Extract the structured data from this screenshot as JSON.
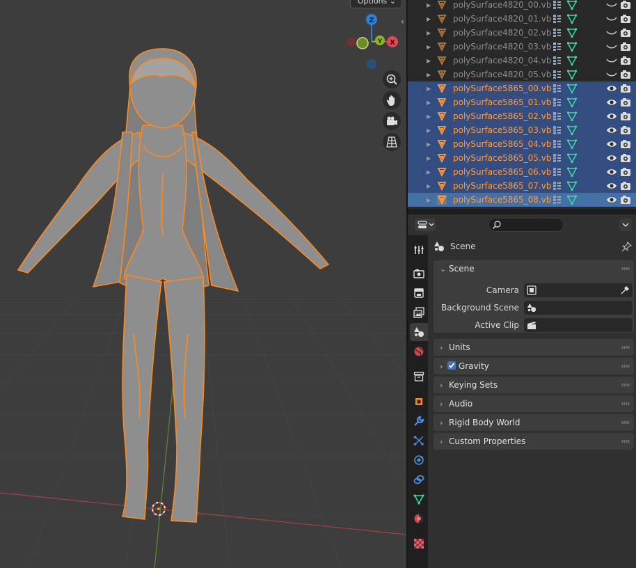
{
  "viewport": {
    "options_label": "Options",
    "gizmo": {
      "z": "Z",
      "y": "Y",
      "x": "X"
    },
    "nav_buttons": [
      "zoom-in-icon",
      "pan-hand-icon",
      "camera-view-icon",
      "perspective-grid-icon"
    ]
  },
  "outliner": {
    "rows": [
      {
        "name": "polySurface4820_00.vb",
        "selected": false
      },
      {
        "name": "polySurface4820_01.vb",
        "selected": false
      },
      {
        "name": "polySurface4820_02.vb",
        "selected": false
      },
      {
        "name": "polySurface4820_03.vb",
        "selected": false
      },
      {
        "name": "polySurface4820_04.vb",
        "selected": false
      },
      {
        "name": "polySurface4820_05.vb",
        "selected": false
      },
      {
        "name": "polySurface5865_00.vb",
        "selected": true
      },
      {
        "name": "polySurface5865_01.vb",
        "selected": true
      },
      {
        "name": "polySurface5865_02.vb",
        "selected": true
      },
      {
        "name": "polySurface5865_03.vb",
        "selected": true
      },
      {
        "name": "polySurface5865_04.vb",
        "selected": true
      },
      {
        "name": "polySurface5865_05.vb",
        "selected": true
      },
      {
        "name": "polySurface5865_06.vb",
        "selected": true
      },
      {
        "name": "polySurface5865_07.vb",
        "selected": true
      },
      {
        "name": "polySurface5865_08.vb",
        "selected": true,
        "active": true
      }
    ]
  },
  "properties": {
    "context_title": "Scene",
    "scene_panel": {
      "title": "Scene",
      "fields": [
        {
          "label": "Camera"
        },
        {
          "label": "Background Scene"
        },
        {
          "label": "Active Clip"
        }
      ]
    },
    "collapsed_panels": [
      "Units",
      "Gravity",
      "Keying Sets",
      "Audio",
      "Rigid Body World",
      "Custom Properties"
    ],
    "gravity_checked": true
  },
  "colors": {
    "selection_orange": "#ff9d42",
    "outliner_selected": "#334d80",
    "outliner_active": "#4470a6",
    "axis_x": "#e3475a",
    "axis_y": "#86b527",
    "axis_z": "#2f7fd4"
  }
}
